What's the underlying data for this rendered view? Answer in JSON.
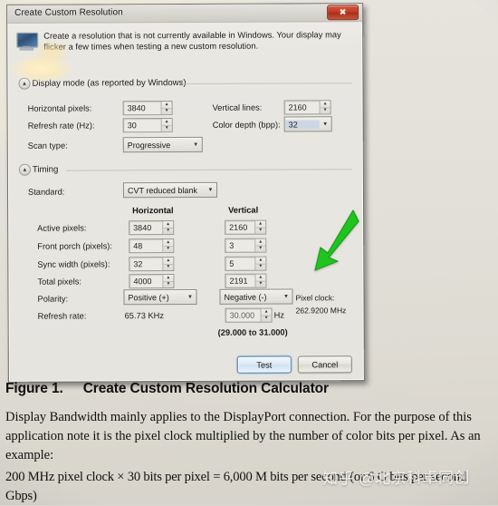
{
  "dialog": {
    "title": "Create Custom Resolution",
    "close_label": "✖",
    "info_text": "Create a resolution that is not currently available in Windows. Your display may flicker a few times when testing a new custom resolution.",
    "monitor_icon": "monitor-icon"
  },
  "display_mode": {
    "header": "Display mode (as reported by Windows)",
    "horizontal_pixels_label": "Horizontal pixels:",
    "horizontal_pixels_value": "3840",
    "vertical_lines_label": "Vertical lines:",
    "vertical_lines_value": "2160",
    "refresh_rate_label": "Refresh rate (Hz):",
    "refresh_rate_value": "30",
    "color_depth_label": "Color depth (bpp):",
    "color_depth_value": "32",
    "scan_type_label": "Scan type:",
    "scan_type_value": "Progressive"
  },
  "timing": {
    "header": "Timing",
    "standard_label": "Standard:",
    "standard_value": "CVT reduced blank",
    "col_horizontal": "Horizontal",
    "col_vertical": "Vertical",
    "rows": [
      {
        "label": "Active pixels:",
        "h": "3840",
        "v": "2160"
      },
      {
        "label": "Front porch (pixels):",
        "h": "48",
        "v": "3"
      },
      {
        "label": "Sync width (pixels):",
        "h": "32",
        "v": "5"
      },
      {
        "label": "Total pixels:",
        "h": "4000",
        "v": "2191"
      }
    ],
    "polarity_label": "Polarity:",
    "polarity_h": "Positive (+)",
    "polarity_v": "Negative (-)",
    "refresh_rate_label": "Refresh rate:",
    "refresh_rate_h": "65.73 KHz",
    "refresh_rate_v": "30.000",
    "refresh_rate_unit": "Hz",
    "refresh_rate_range": "(29.000 to 31.000)",
    "pixel_clock_label": "Pixel clock:",
    "pixel_clock_value": "262.9200 MHz"
  },
  "buttons": {
    "test": "Test",
    "cancel": "Cancel"
  },
  "annotation": {
    "arrow_color": "#21c321",
    "arrow_name": "green-arrow-pointing-to-pixel-clock"
  },
  "figure": {
    "number": "Figure 1.",
    "caption": "Create Custom Resolution Calculator"
  },
  "prose": {
    "paragraph": "Display Bandwidth mainly applies to the DisplayPort connection. For the purpose of this application note it is the pixel clock multiplied by the number of color bits per pixel. As an example:",
    "example_line1": "200 MHz pixel clock × 30 bits per pixel = 6,000 M bits per second (or 6 G bits per second",
    "example_line2": "Gbps)"
  },
  "watermark": {
    "text": "知乎 @北京科卓同创"
  }
}
